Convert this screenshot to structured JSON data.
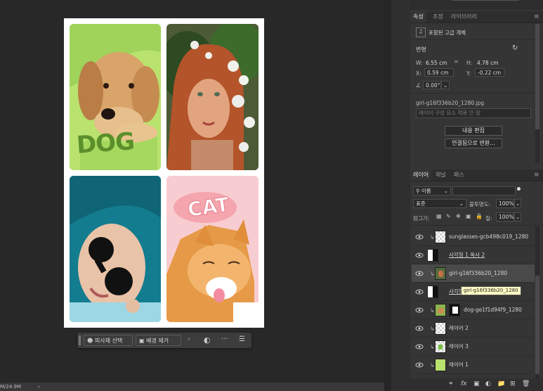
{
  "canvas": {
    "labels": {
      "dog": "DOG",
      "cat": "CAT"
    }
  },
  "context_bar": {
    "select_subject": "피사체 선택",
    "remove_background": "배경 제거",
    "more": "···"
  },
  "status_bar": {
    "text": "M/24.9M",
    "arrow": "›"
  },
  "properties_panel": {
    "tabs": [
      "속성",
      "조정",
      "라이브러리"
    ],
    "object_type": "포함된 고급 개체",
    "transform_title": "변형",
    "w_label": "W:",
    "w_value": "6.55 cm",
    "h_label": "H:",
    "h_value": "4.78 cm",
    "x_label": "X:",
    "x_value": "0.59 cm",
    "y_label": "Y:",
    "y_value": "-0.22 cm",
    "angle_value": "0.00°",
    "filename": "girl-g16f336b20_1280.jpg",
    "layer_comp_placeholder": "레이어 구성 요소 적용 안 함",
    "edit_contents_button": "내용 편집",
    "convert_linked_button": "연결됨으로 변환..."
  },
  "layers_panel": {
    "tabs": [
      "레이어",
      "채널",
      "패스"
    ],
    "filter_kind": "이름",
    "blend_mode": "표준",
    "opacity_label": "불투명도:",
    "opacity_value": "100%",
    "lock_label": "잠그기:",
    "fill_label": "칠:",
    "fill_value": "100%",
    "tooltip": "girl-g16f336b20_1280",
    "layers": [
      {
        "name": "sunglasses-gcb498c019_1280"
      },
      {
        "name": "사각형 1 복사 2"
      },
      {
        "name": "girl-g16f336b20_1280"
      },
      {
        "name": "사각형 1 복사"
      },
      {
        "name": "dog-ge1f1d94f9_1280"
      },
      {
        "name": "레이어 2"
      },
      {
        "name": "레이어 3"
      },
      {
        "name": "레이어 1"
      }
    ],
    "footer_icons": [
      "link-icon",
      "fx-icon",
      "mask-icon",
      "adjustment-icon",
      "folder-icon",
      "new-layer-icon",
      "trash-icon"
    ],
    "fx_label": "fx"
  },
  "colors": {
    "dog_bg": "#b9e26f",
    "cat_bg": "#f8c9cf",
    "teal_hair": "#1b8fa3",
    "panel_bg": "#353535"
  }
}
